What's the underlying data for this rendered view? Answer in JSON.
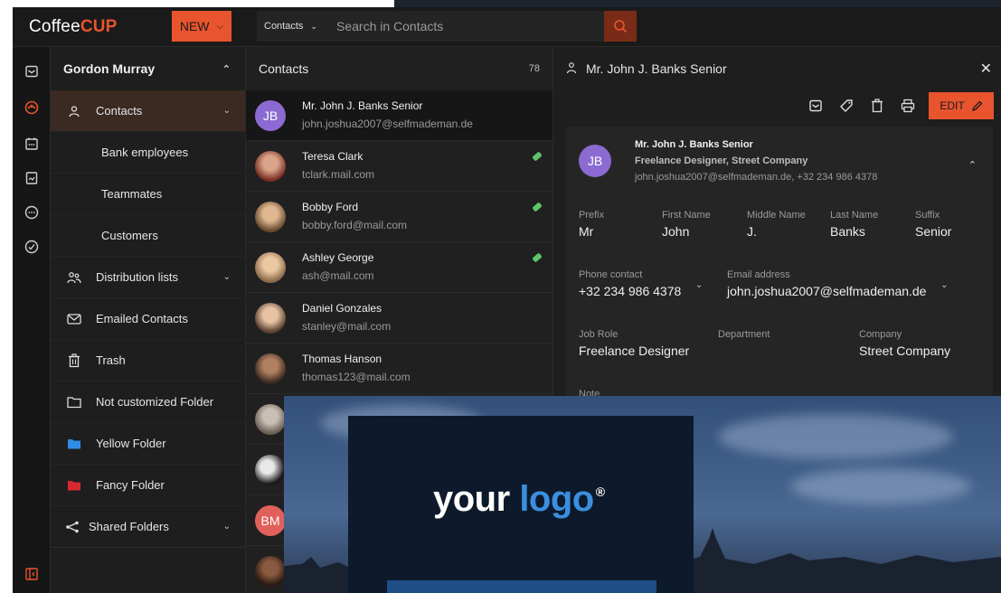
{
  "app": {
    "logo_prefix": "Coffee",
    "logo_suffix": "CUP",
    "new_label": "NEW"
  },
  "search": {
    "scope": "Contacts",
    "placeholder": "Search in Contacts"
  },
  "sidebar": {
    "user": "Gordon Murray",
    "items": [
      {
        "label": "Contacts",
        "icon": "person-icon"
      },
      {
        "label": "Bank employees"
      },
      {
        "label": "Teammates"
      },
      {
        "label": "Customers"
      },
      {
        "label": "Distribution lists",
        "icon": "group-icon"
      },
      {
        "label": "Emailed Contacts",
        "icon": "envelope-icon"
      },
      {
        "label": "Trash",
        "icon": "trash-icon"
      },
      {
        "label": "Not customized Folder",
        "icon": "folder-icon"
      },
      {
        "label": "Yellow Folder",
        "icon": "folder-icon",
        "color": "#2e8ce6"
      },
      {
        "label": "Fancy Folder",
        "icon": "folder-icon",
        "color": "#d8282f"
      },
      {
        "label": "Shared Folders",
        "icon": "share-icon"
      }
    ]
  },
  "list": {
    "title": "Contacts",
    "count": "78",
    "rows": [
      {
        "name": "Mr. John J. Banks Senior",
        "email": "john.joshua2007@selfmademan.de",
        "initials": "JB",
        "color": "#8b6bd1"
      },
      {
        "name": "Teresa Clark",
        "email": "tclark.mail.com",
        "color": "#a0523a"
      },
      {
        "name": "Bobby Ford",
        "email": "bobby.ford@mail.com",
        "color": "#b98a5c"
      },
      {
        "name": "Ashley George",
        "email": "ash@mail.com",
        "color": "#c9a27a"
      },
      {
        "name": "Daniel Gonzales",
        "email": "stanley@mail.com",
        "color": "#b58c6a"
      },
      {
        "name": "Thomas Hanson",
        "email": "thomas123@mail.com",
        "color": "#7c5a3e"
      },
      {
        "name": "",
        "email": "",
        "color": "#9b8f86"
      },
      {
        "name": "",
        "email": "",
        "color": "#444444"
      },
      {
        "name": "",
        "email": "",
        "initials": "BM",
        "color": "#e0605a"
      },
      {
        "name": "",
        "email": "",
        "color": "#5a3a2c"
      }
    ]
  },
  "detail": {
    "title": "Mr. John J. Banks Senior",
    "edit_label": "EDIT",
    "initials": "JB",
    "name": "Mr. John J. Banks Senior",
    "role_company": "Freelance Designer, Street Company",
    "email_phone": "john.joshua2007@selfmademan.de, +32 234 986 4378",
    "fields": {
      "prefix": {
        "label": "Prefix",
        "value": "Mr"
      },
      "first": {
        "label": "First Name",
        "value": "John"
      },
      "middle": {
        "label": "Middle Name",
        "value": "J."
      },
      "last": {
        "label": "Last Name",
        "value": "Banks"
      },
      "suffix": {
        "label": "Suffix",
        "value": "Senior"
      },
      "phone": {
        "label": "Phone contact",
        "value": "+32 234 986 4378"
      },
      "email": {
        "label": "Email address",
        "value": "john.joshua2007@selfmademan.de"
      },
      "job": {
        "label": "Job Role",
        "value": "Freelance Designer"
      },
      "dept": {
        "label": "Department",
        "value": ""
      },
      "company": {
        "label": "Company",
        "value": "Street Company"
      },
      "note": {
        "label": "Note"
      }
    }
  },
  "banner": {
    "logo_word1": "your",
    "logo_word2": "logo",
    "logo_mark": "®"
  },
  "colors": {
    "accent": "#e8542e",
    "tag": "#5cc46b"
  }
}
